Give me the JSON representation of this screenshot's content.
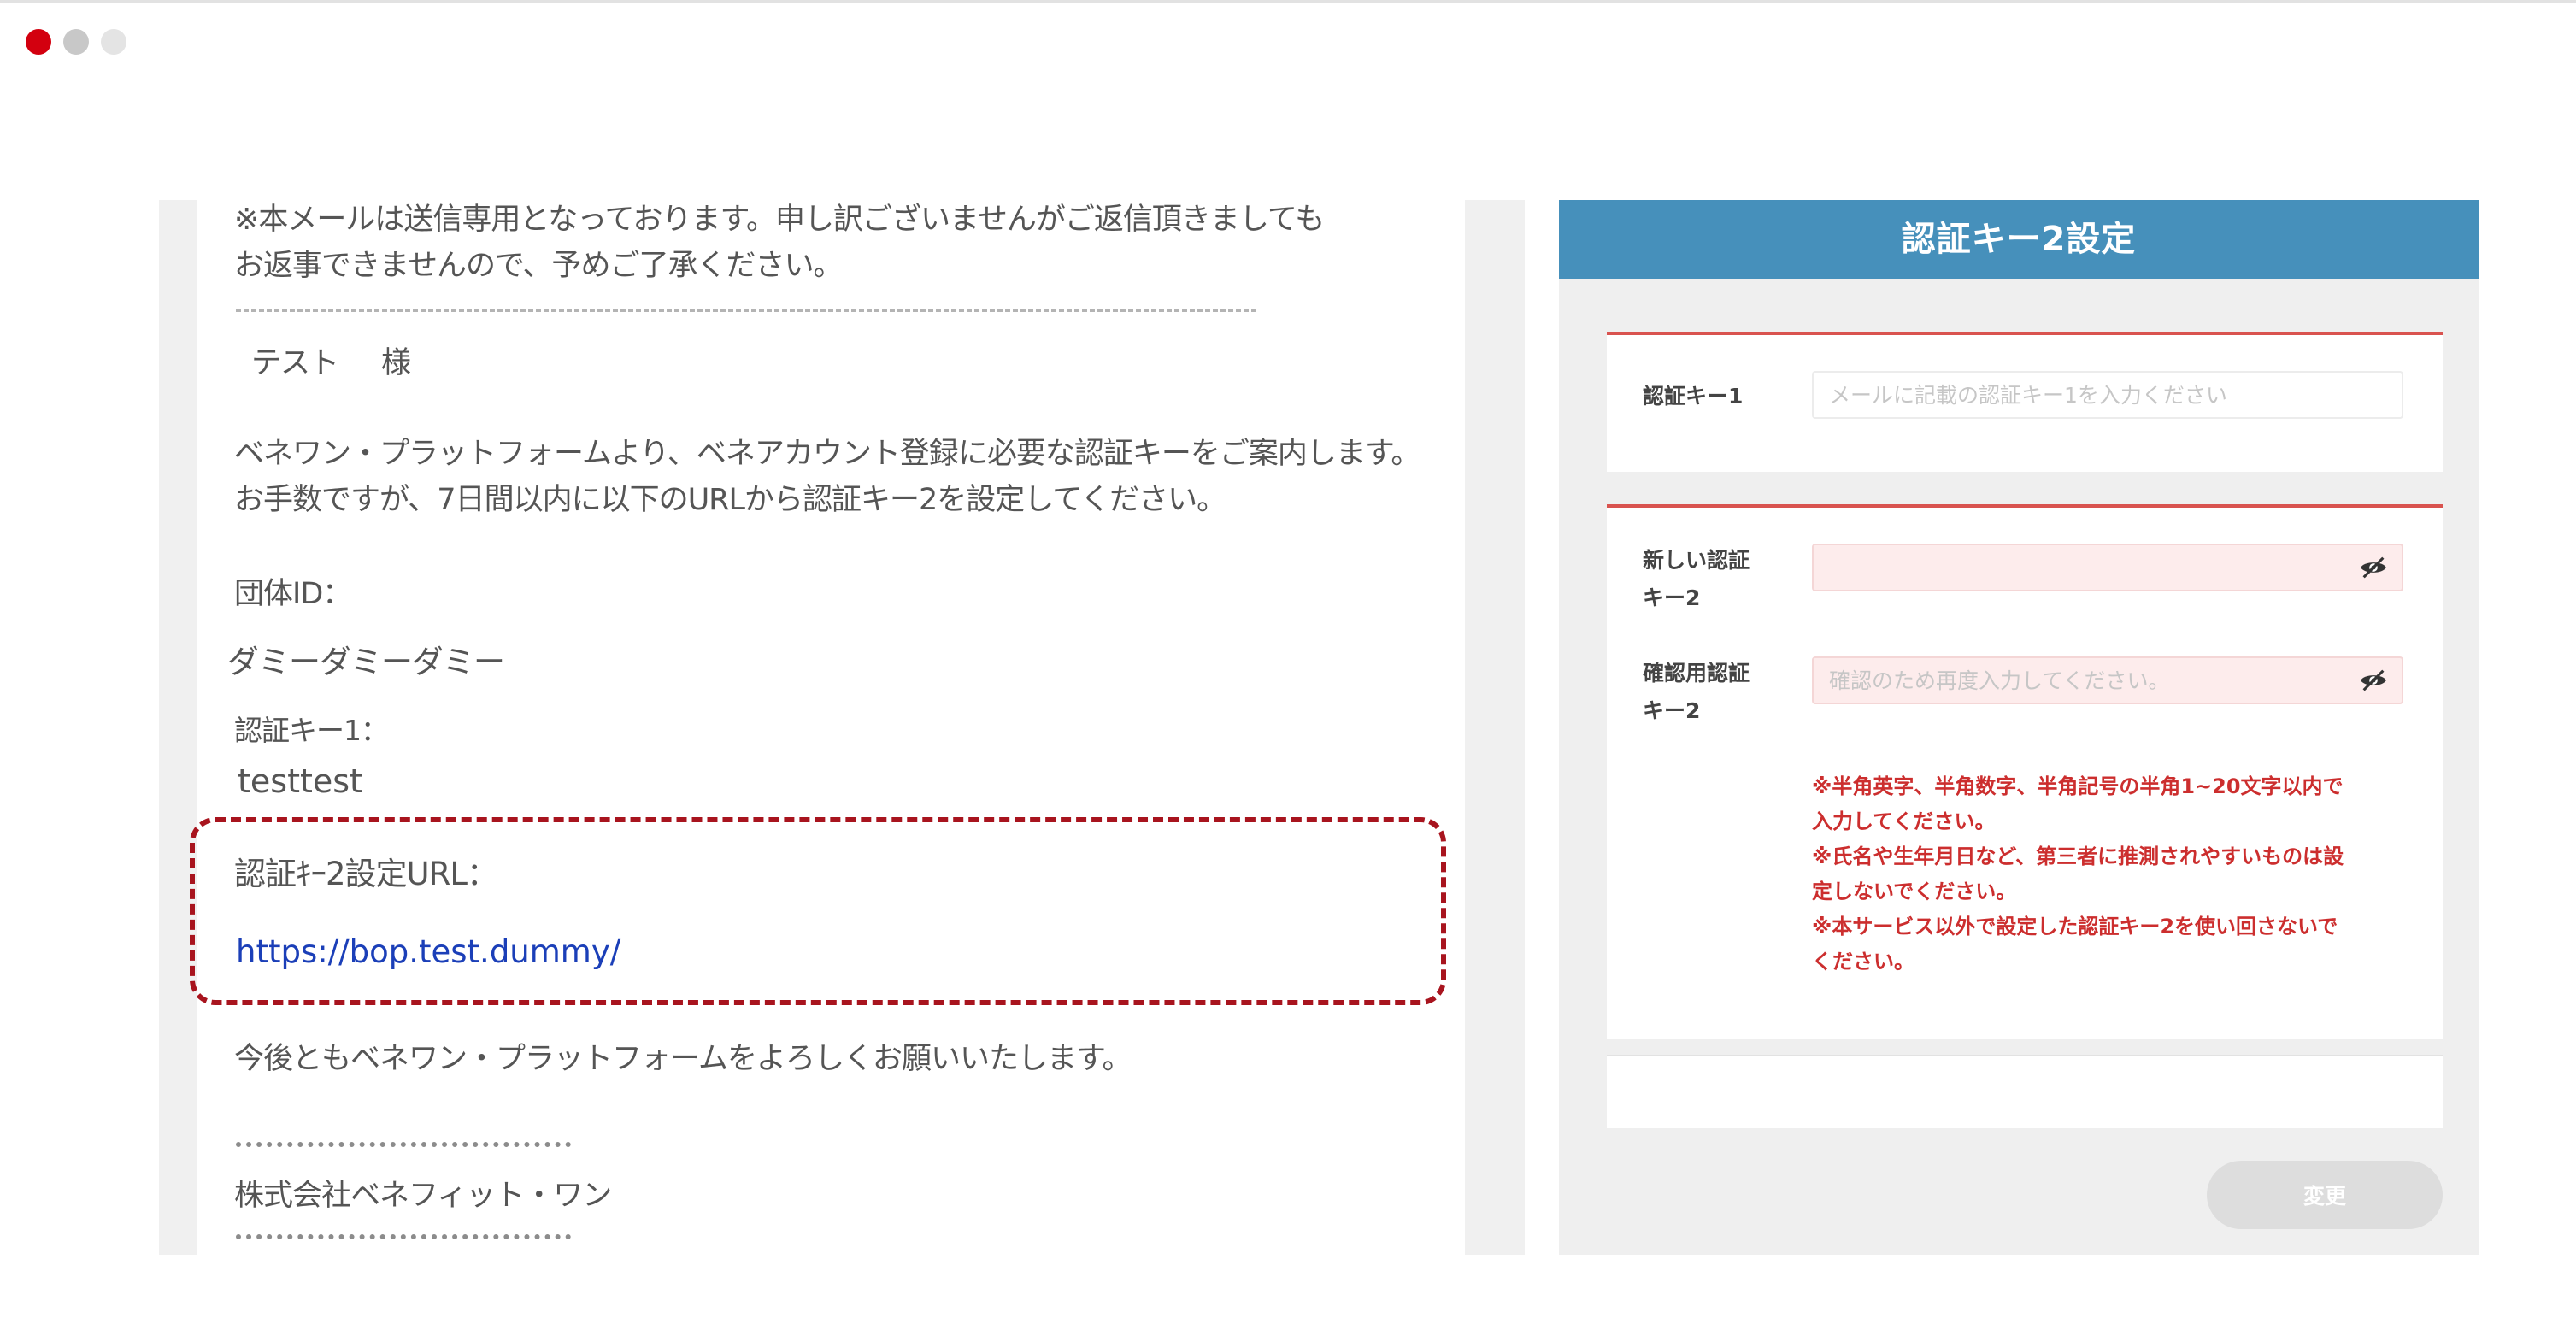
{
  "window": {
    "controls": [
      "close",
      "minimize",
      "zoom"
    ]
  },
  "email": {
    "notice_line1": "※本メールは送信専用となっております。申し訳ございませんがご返信頂きましても",
    "notice_line2": "お返事できませんので、予めご了承ください。",
    "recipient_name": "テスト",
    "recipient_honorific": "様",
    "intro_line1": "ベネワン・プラットフォームより、ベネアカウント登録に必要な認証キーをご案内します。",
    "intro_line2": "お手数ですが、7日間以内に以下のURLから認証キー2を設定してください。",
    "group_id_label": "団体ID：",
    "group_id_value": "ダミーダミーダミー",
    "auth_key1_label": "認証キー1：",
    "auth_key1_value": "testtest",
    "setup_url_label": "認証ｷｰ2設定URL：",
    "setup_url": "https://bop.test.dummy/",
    "closing": "今後ともベネワン・プラットフォームをよろしくお願いいたします。",
    "signature_company": "株式会社ベネフィット・ワン"
  },
  "settings": {
    "title": "認証キー2設定",
    "auth_key1_label": "認証キー1",
    "auth_key1_placeholder": "メールに記載の認証キー1を入力ください",
    "new_key2_label_line1": "新しい認証",
    "new_key2_label_line2": "キー2",
    "new_key2_value": "",
    "confirm_key2_label_line1": "確認用認証",
    "confirm_key2_label_line2": "キー2",
    "confirm_key2_placeholder": "確認のため再度入力してください。",
    "notes": [
      "※半角英字、半角数字、半角記号の半角1~20文字以内で",
      "入力してください。",
      "※氏名や生年月日など、第三者に推測されやすいものは設",
      "定しないでください。",
      "※本サービス以外で設定した認証キー2を使い回さないで",
      "ください。"
    ],
    "submit_label": "変更",
    "colors": {
      "header": "#4690bb",
      "accent_border": "#d9534f",
      "note_text": "#cc2e2e",
      "input_pink": "#fdecec",
      "link": "#1b3fb8",
      "highlight_border": "#a8141e"
    }
  }
}
